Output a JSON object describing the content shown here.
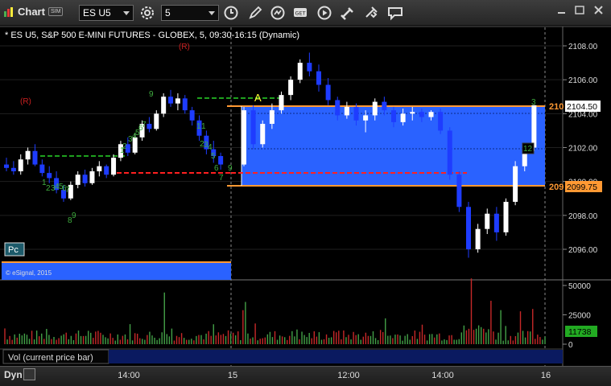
{
  "titlebar": {
    "title": "Chart",
    "sim_badge": "SIM",
    "symbol_value": "ES U5",
    "interval_value": "5",
    "toolbar_icons": [
      "gear-icon",
      "clock-icon",
      "pencil-icon",
      "refresh-icon",
      "get-icon",
      "play-icon",
      "tools-icon",
      "chat-icon"
    ],
    "icon_get_label": "GET"
  },
  "chart": {
    "header": "* ES U5, S&P 500 E-MINI FUTURES - GLOBEX, 5, 09:30-16:15 (Dynamic)",
    "copyright": "© eSignal, 2015",
    "pc_label": "Pc",
    "marker_a": "A",
    "marker_r1": "(R)",
    "marker_r2": "(R)",
    "price_axis": [
      "2108.00",
      "2106.00",
      "2104.00",
      "2102.00",
      "2100.00",
      "2098.00",
      "2096.00"
    ],
    "price_axis_values": [
      2108,
      2106,
      2104,
      2102,
      2100,
      2098,
      2096
    ],
    "last_price": "2104.50",
    "level_upper_label": "210",
    "level_lower_label": "209",
    "level_lower_price": "2099.75",
    "count_label_12": "12",
    "count_label_3": "3",
    "colors": {
      "up": "#ffffff",
      "down": "#1e3cff",
      "box_fill": "#2a62ff",
      "orange": "#ff9933",
      "red_dash": "#ff2020",
      "green_dash": "#1ea01e",
      "seq_green": "#3fae3f",
      "price_tag_green": "#22aa22"
    }
  },
  "volume": {
    "label": "Vol (current price bar)",
    "axis": [
      "50000",
      "25000",
      "0"
    ],
    "axis_values": [
      50000,
      25000,
      0
    ],
    "last_value": "11738"
  },
  "x_axis": [
    "14:00",
    "15",
    "12:00",
    "14:00",
    "16"
  ],
  "bottombar": {
    "dyn_label": "Dyn"
  },
  "chart_data": {
    "type": "candlestick",
    "series": [
      {
        "name": "ES U5",
        "ohlc": [
          [
            2101.0,
            2101.4,
            2100.6,
            2100.8
          ],
          [
            2100.8,
            2101.2,
            2100.4,
            2100.6
          ],
          [
            2100.6,
            2101.6,
            2100.4,
            2101.3
          ],
          [
            2101.3,
            2102.0,
            2101.0,
            2101.8
          ],
          [
            2101.8,
            2102.2,
            2100.9,
            2101.0
          ],
          [
            2101.0,
            2101.3,
            2100.3,
            2100.5
          ],
          [
            2100.5,
            2100.9,
            2099.9,
            2100.2
          ],
          [
            2100.2,
            2100.6,
            2099.3,
            2099.5
          ],
          [
            2099.5,
            2099.8,
            2098.8,
            2099.0
          ],
          [
            2099.0,
            2100.0,
            2098.9,
            2099.8
          ],
          [
            2099.8,
            2100.6,
            2099.6,
            2100.4
          ],
          [
            2100.4,
            2100.7,
            2099.7,
            2099.9
          ],
          [
            2099.9,
            2100.8,
            2099.8,
            2100.6
          ],
          [
            2100.6,
            2101.2,
            2100.3,
            2100.9
          ],
          [
            2100.9,
            2101.0,
            2100.2,
            2100.4
          ],
          [
            2100.4,
            2101.6,
            2100.3,
            2101.4
          ],
          [
            2101.4,
            2102.4,
            2101.2,
            2102.2
          ],
          [
            2102.2,
            2102.6,
            2101.5,
            2101.7
          ],
          [
            2101.7,
            2102.8,
            2101.6,
            2102.6
          ],
          [
            2102.6,
            2103.6,
            2102.4,
            2103.4
          ],
          [
            2103.4,
            2103.8,
            2102.9,
            2103.1
          ],
          [
            2103.1,
            2104.2,
            2103.0,
            2104.0
          ],
          [
            2104.0,
            2105.2,
            2103.8,
            2105.0
          ],
          [
            2105.0,
            2105.4,
            2104.4,
            2104.6
          ],
          [
            2104.6,
            2105.2,
            2104.2,
            2104.9
          ],
          [
            2104.9,
            2105.1,
            2104.0,
            2104.2
          ],
          [
            2104.2,
            2104.4,
            2103.3,
            2103.6
          ],
          [
            2103.6,
            2103.9,
            2102.4,
            2102.7
          ],
          [
            2102.7,
            2103.0,
            2101.6,
            2101.9
          ],
          [
            2101.9,
            2102.4,
            2101.1,
            2101.5
          ],
          [
            2101.5,
            2101.7,
            2100.7,
            2101.0
          ],
          [
            2101.0,
            2104.4,
            2100.9,
            2104.2
          ],
          [
            2104.2,
            2104.5,
            2101.9,
            2102.2
          ],
          [
            2102.2,
            2103.6,
            2102.0,
            2103.4
          ],
          [
            2103.4,
            2104.6,
            2103.1,
            2104.2
          ],
          [
            2104.2,
            2105.3,
            2104.0,
            2105.1
          ],
          [
            2105.1,
            2106.2,
            2104.8,
            2106.0
          ],
          [
            2106.0,
            2107.2,
            2105.8,
            2107.0
          ],
          [
            2107.0,
            2107.6,
            2106.2,
            2106.5
          ],
          [
            2106.5,
            2106.9,
            2105.3,
            2105.7
          ],
          [
            2105.7,
            2106.1,
            2104.5,
            2104.8
          ],
          [
            2104.8,
            2105.0,
            2103.6,
            2103.9
          ],
          [
            2103.9,
            2104.7,
            2103.7,
            2104.4
          ],
          [
            2104.4,
            2104.6,
            2103.3,
            2103.6
          ],
          [
            2103.6,
            2104.2,
            2102.9,
            2103.9
          ],
          [
            2103.9,
            2104.9,
            2103.6,
            2104.7
          ],
          [
            2104.7,
            2105.0,
            2103.9,
            2104.2
          ],
          [
            2104.2,
            2104.4,
            2103.2,
            2103.5
          ],
          [
            2103.5,
            2104.3,
            2103.3,
            2104.0
          ],
          [
            2104.0,
            2104.4,
            2103.6,
            2104.1
          ],
          [
            2104.1,
            2104.3,
            2103.5,
            2103.8
          ],
          [
            2103.8,
            2104.2,
            2103.6,
            2104.1
          ],
          [
            2104.1,
            2104.3,
            2102.8,
            2103.0
          ],
          [
            2103.0,
            2103.2,
            2100.1,
            2100.4
          ],
          [
            2100.4,
            2100.6,
            2098.2,
            2098.5
          ],
          [
            2098.5,
            2098.8,
            2095.5,
            2096.0
          ],
          [
            2096.0,
            2097.5,
            2095.8,
            2097.2
          ],
          [
            2097.2,
            2098.4,
            2096.9,
            2098.1
          ],
          [
            2098.1,
            2098.5,
            2096.5,
            2097.0
          ],
          [
            2097.0,
            2099.0,
            2096.8,
            2098.8
          ],
          [
            2098.8,
            2101.2,
            2098.6,
            2100.9
          ],
          [
            2100.9,
            2102.2,
            2100.6,
            2102.0
          ],
          [
            2102.0,
            2104.5,
            2101.8,
            2104.5
          ]
        ]
      }
    ],
    "ylim": [
      2095,
      2108.6
    ]
  }
}
